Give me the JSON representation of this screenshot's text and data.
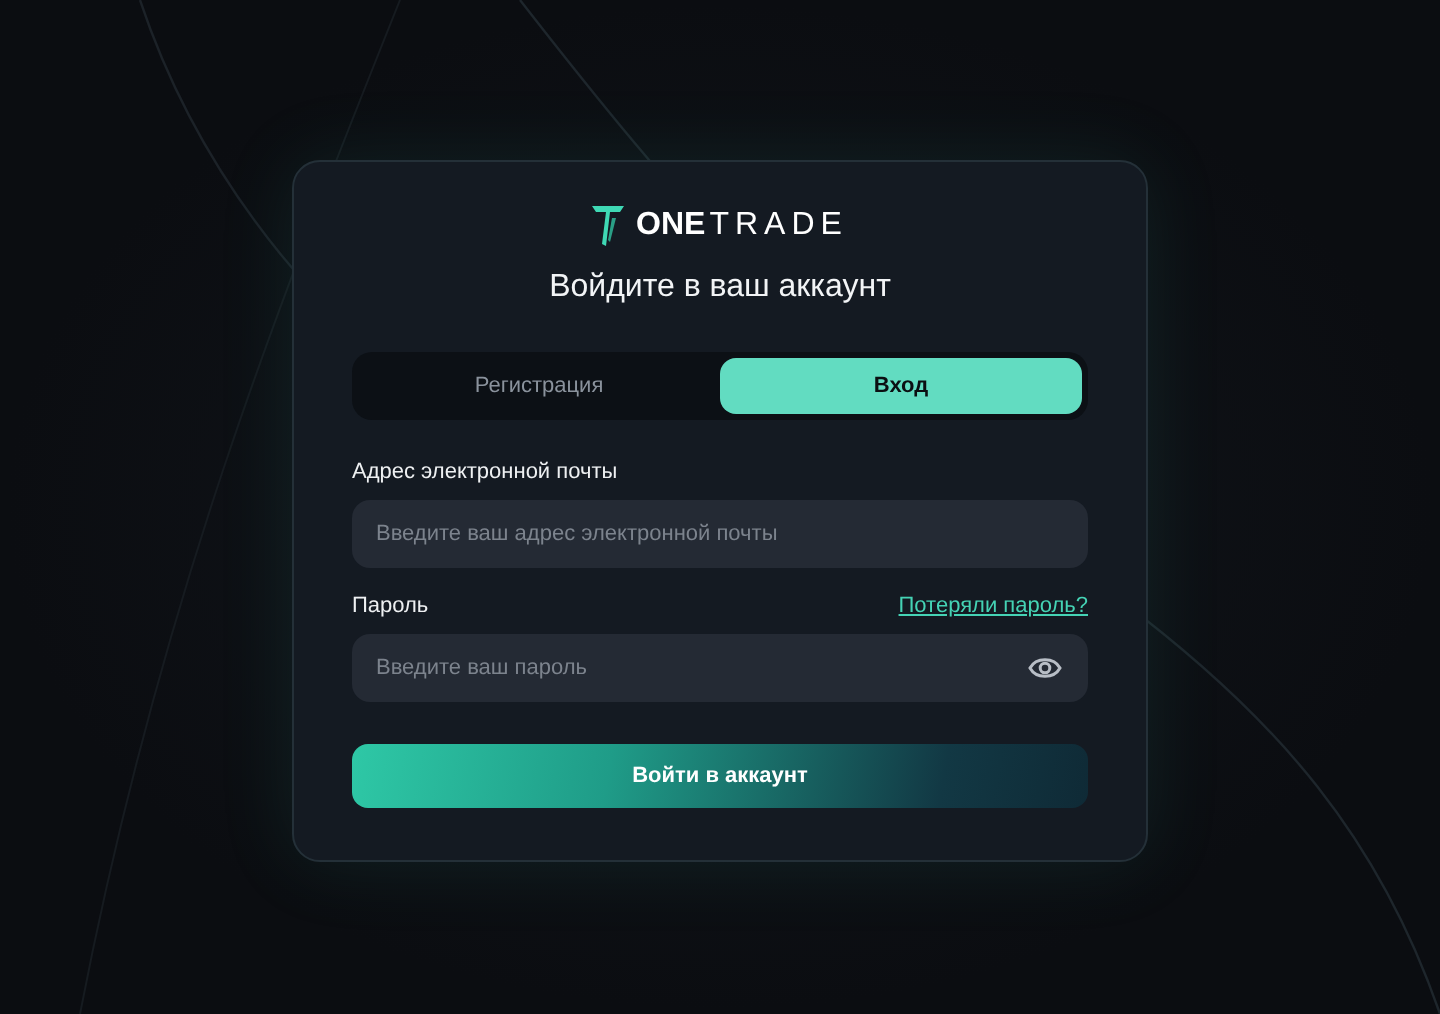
{
  "logo": {
    "strong": "ONE",
    "light": "TRADE"
  },
  "title": "Войдите в ваш аккаунт",
  "tabs": [
    {
      "label": "Регистрация",
      "selected": false
    },
    {
      "label": "Вход",
      "selected": true
    }
  ],
  "email": {
    "label": "Адрес электронной почты",
    "placeholder": "Введите ваш адрес электронной почты"
  },
  "password": {
    "label": "Пароль",
    "forgot_link": "Потеряли пароль?",
    "placeholder": "Введите ваш пароль"
  },
  "submit": "Войти в аккаунт"
}
